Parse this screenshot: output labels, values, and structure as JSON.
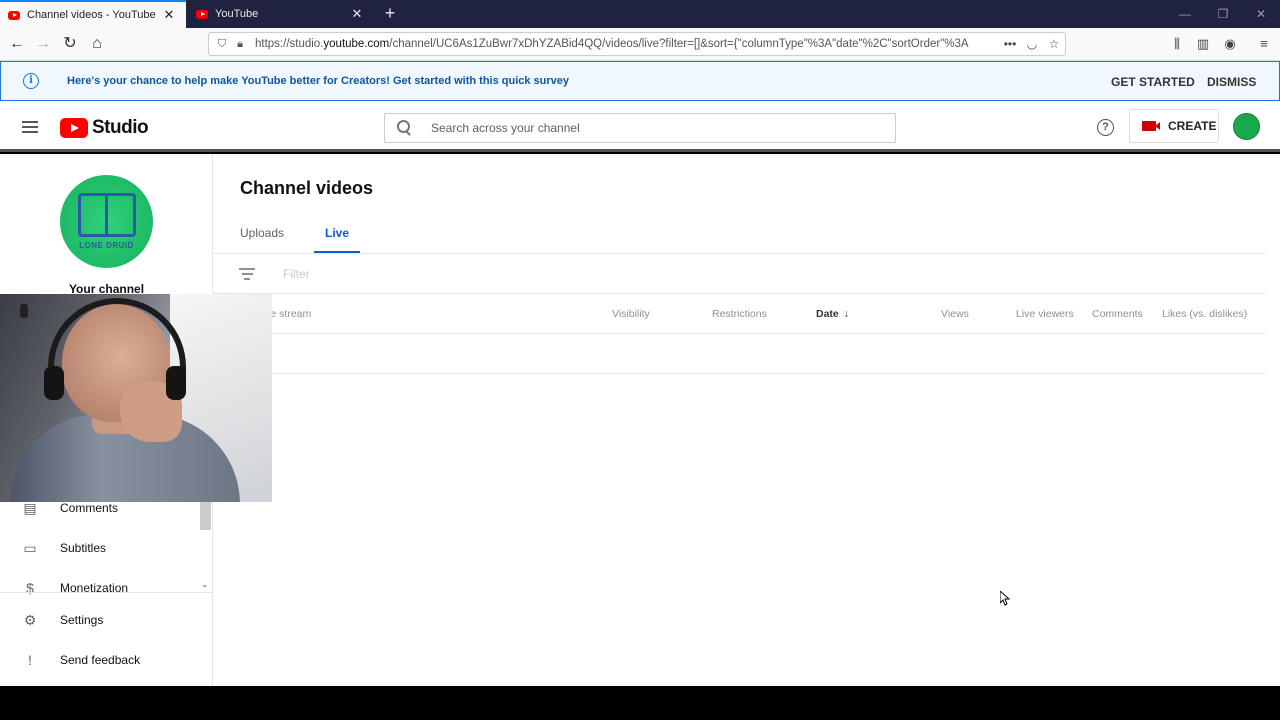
{
  "browser": {
    "tabs": [
      {
        "title": "Channel videos - YouTube Studio",
        "active": true
      },
      {
        "title": "YouTube",
        "active": false
      }
    ],
    "url": {
      "prefix": "https://studio.",
      "domain": "youtube.com",
      "path": "/channel/UC6As1ZuBwr7xDhYZABid4QQ/videos/live?filter=[]&sort={\"columnType\"%3A\"date\"%2C\"sortOrder\"%3A"
    }
  },
  "banner": {
    "text": "Here's your chance to help make YouTube better for Creators! Get started with this quick survey",
    "get_started": "GET STARTED",
    "dismiss": "DISMISS"
  },
  "header": {
    "logo_text": "Studio",
    "search_placeholder": "Search across your channel",
    "create_label": "CREATE",
    "help_glyph": "?"
  },
  "sidebar": {
    "channel_label": "Your channel",
    "avatar_text": "LONE DRUID",
    "items": [
      {
        "label": "Comments",
        "icon": "comment-icon",
        "glyph": "▤"
      },
      {
        "label": "Subtitles",
        "icon": "subtitles-icon",
        "glyph": "▭"
      },
      {
        "label": "Monetization",
        "icon": "dollar-icon",
        "glyph": "$"
      },
      {
        "label": "Settings",
        "icon": "gear-icon",
        "glyph": "⚙"
      },
      {
        "label": "Send feedback",
        "icon": "feedback-icon",
        "glyph": "!"
      }
    ]
  },
  "main": {
    "title": "Channel videos",
    "tabs": [
      {
        "label": "Uploads",
        "active": false
      },
      {
        "label": "Live",
        "active": true
      }
    ],
    "filter_placeholder": "Filter",
    "columns": [
      {
        "label": "Live stream"
      },
      {
        "label": "Visibility"
      },
      {
        "label": "Restrictions"
      },
      {
        "label": "Date",
        "sorted": "desc"
      },
      {
        "label": "Views"
      },
      {
        "label": "Live viewers"
      },
      {
        "label": "Comments"
      },
      {
        "label": "Likes (vs. dislikes)"
      }
    ]
  },
  "colors": {
    "accent_blue": "#065fd4",
    "youtube_red": "#ff0000",
    "banner_bg": "#f0f7fd"
  }
}
